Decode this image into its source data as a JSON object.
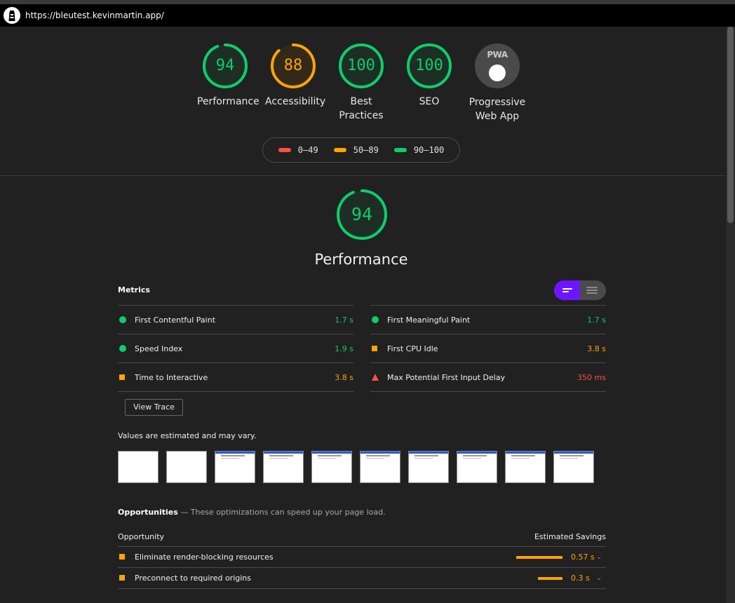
{
  "browser": {
    "url": "https://bleutest.kevinmartin.app/"
  },
  "categories": [
    {
      "label": "Performance",
      "score": "94",
      "score_value": 94,
      "color": "#0cce6b"
    },
    {
      "label": "Accessibility",
      "score": "88",
      "score_value": 88,
      "color": "#ffa400"
    },
    {
      "label_line1": "Best",
      "label_line2": "Practices",
      "score": "100",
      "score_value": 100,
      "color": "#0cce6b"
    },
    {
      "label": "SEO",
      "score": "100",
      "score_value": 100,
      "color": "#0cce6b"
    }
  ],
  "pwa": {
    "badge_text": "PWA",
    "label_line1": "Progressive",
    "label_line2": "Web App"
  },
  "legend": [
    {
      "range": "0–49",
      "color": "#ff4e42"
    },
    {
      "range": "50–89",
      "color": "#ffa400"
    },
    {
      "range": "90–100",
      "color": "#0cce6b"
    }
  ],
  "performance": {
    "score": "94",
    "score_value": 94,
    "title": "Performance",
    "metrics_heading": "Metrics",
    "metrics_left": [
      {
        "name": "First Contentful Paint",
        "value": "1.7 s",
        "status": "pass",
        "icon": "circle-icon"
      },
      {
        "name": "Speed Index",
        "value": "1.9 s",
        "status": "pass",
        "icon": "circle-icon"
      },
      {
        "name": "Time to Interactive",
        "value": "3.8 s",
        "status": "average",
        "icon": "square-icon"
      }
    ],
    "metrics_right": [
      {
        "name": "First Meaningful Paint",
        "value": "1.7 s",
        "status": "pass",
        "icon": "circle-icon"
      },
      {
        "name": "First CPU Idle",
        "value": "3.8 s",
        "status": "average",
        "icon": "square-icon"
      },
      {
        "name": "Max Potential First Input Delay",
        "value": "350 ms",
        "status": "fail",
        "icon": "triangle-icon"
      }
    ],
    "view_trace_label": "View Trace",
    "note": "Values are estimated and may vary.",
    "filmstrip_frames": 10,
    "opportunities": {
      "heading": "Opportunities",
      "description": "— These optimizations can speed up your page load.",
      "col_opportunity": "Opportunity",
      "col_savings": "Estimated Savings",
      "rows": [
        {
          "name": "Eliminate render-blocking resources",
          "savings": "0.57 s",
          "savings_value": 0.57
        },
        {
          "name": "Preconnect to required origins",
          "savings": "0.3 s",
          "savings_value": 0.3
        }
      ]
    }
  }
}
